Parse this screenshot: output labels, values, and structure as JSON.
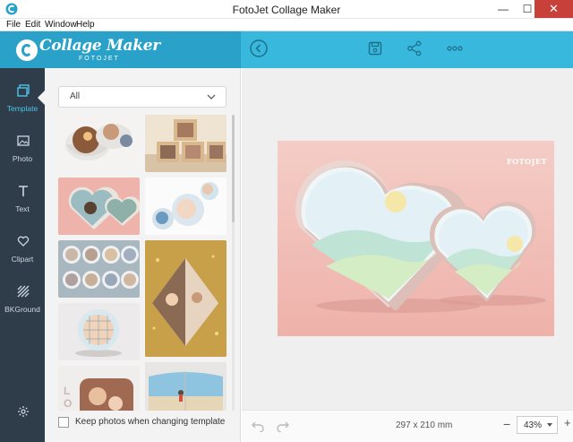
{
  "window": {
    "title": "FotoJet Collage Maker",
    "min": "—",
    "max": "☐",
    "close": "✕"
  },
  "menu": {
    "items": [
      "File",
      "Edit",
      "Window",
      "Help"
    ]
  },
  "header": {
    "logo_text": "Collage Maker",
    "logo_sub": "FOTOJET",
    "icons": [
      "back-icon",
      "save-icon",
      "share-icon",
      "more-icon"
    ]
  },
  "nav": {
    "items": [
      {
        "label": "Template",
        "icon": "template-icon",
        "active": true
      },
      {
        "label": "Photo",
        "icon": "photo-icon",
        "active": false
      },
      {
        "label": "Text",
        "icon": "text-icon",
        "active": false
      },
      {
        "label": "Clipart",
        "icon": "heart-icon",
        "active": false
      },
      {
        "label": "BKGround",
        "icon": "background-icon",
        "active": false
      }
    ],
    "settings_icon": "gear-icon"
  },
  "panel": {
    "filter": {
      "value": "All"
    },
    "keep_photos_label": "Keep photos when changing template",
    "keep_photos_checked": false
  },
  "canvas": {
    "watermark": "FOTOJET",
    "dimensions": "297 x 210 mm",
    "zoom": "43%"
  },
  "colors": {
    "accent": "#38b8dd",
    "nav_bg": "#2f3d4a",
    "canvas_bg": "#f2c2bb",
    "close": "#c7413a"
  }
}
